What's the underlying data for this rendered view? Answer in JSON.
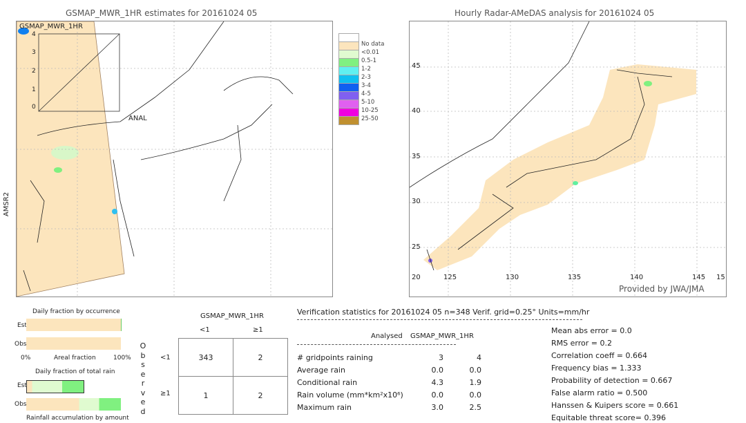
{
  "left_map": {
    "title": "GSMAP_MWR_1HR estimates for 20161024 05",
    "inset_label": "GSMAP_MWR_1HR",
    "inset_ticks": [
      "0",
      "1",
      "2",
      "3",
      "4"
    ],
    "anal_label": "ANAL",
    "side_label": "AMSR2"
  },
  "legend": {
    "items": [
      {
        "label": "",
        "color": "#ffffff"
      },
      {
        "label": "No data",
        "color": "#fce5bd"
      },
      {
        "label": "<0.01",
        "color": "#e0fbd0"
      },
      {
        "label": "0.5-1",
        "color": "#80f080"
      },
      {
        "label": "1-2",
        "color": "#60f0f0"
      },
      {
        "label": "2-3",
        "color": "#10c0f0"
      },
      {
        "label": "3-4",
        "color": "#1060f0"
      },
      {
        "label": "4-5",
        "color": "#8060f0"
      },
      {
        "label": "5-10",
        "color": "#e060f0"
      },
      {
        "label": "10-25",
        "color": "#f000e0"
      },
      {
        "label": "25-50",
        "color": "#c09030"
      }
    ]
  },
  "right_map": {
    "title": "Hourly Radar-AMeDAS analysis for 20161024 05",
    "lat_labels": [
      "45",
      "40",
      "35",
      "30",
      "25",
      "20"
    ],
    "lon_labels": [
      "125",
      "130",
      "135",
      "140",
      "145",
      "15"
    ],
    "credit": "Provided by JWA/JMA"
  },
  "occurrence": {
    "title": "Daily fraction by occurrence",
    "est": "Est",
    "obs": "Obs",
    "x0": "0%",
    "xlabel": "Areal fraction",
    "x1": "100%"
  },
  "total_rain": {
    "title": "Daily fraction of total rain",
    "est": "Est",
    "obs": "Obs",
    "footer": "Rainfall accumulation by amount"
  },
  "contingency": {
    "title": "GSMAP_MWR_1HR",
    "col_headers": [
      "<1",
      "≥1"
    ],
    "row_headers": [
      "<1",
      "≥1"
    ],
    "side_label": "Observed",
    "cells": [
      [
        "343",
        "2"
      ],
      [
        "1",
        "2"
      ]
    ]
  },
  "stats": {
    "header": "Verification statistics for 20161024 05   n=348   Verif. grid=0.25°   Units=mm/hr",
    "col_analysed": "Analysed",
    "col_est": "GSMAP_MWR_1HR",
    "rows": [
      {
        "label": "# gridpoints raining",
        "a": "3",
        "b": "4"
      },
      {
        "label": "Average rain",
        "a": "0.0",
        "b": "0.0"
      },
      {
        "label": "Conditional rain",
        "a": "4.3",
        "b": "1.9"
      },
      {
        "label": "Rain volume (mm*km²x10⁶)",
        "a": "0.0",
        "b": "0.0"
      },
      {
        "label": "Maximum rain",
        "a": "3.0",
        "b": "2.5"
      }
    ],
    "scores": [
      "Mean abs error = 0.0",
      "RMS error = 0.2",
      "Correlation coeff = 0.664",
      "Frequency bias = 1.333",
      "Probability of detection = 0.667",
      "False alarm ratio = 0.500",
      "Hanssen & Kuipers score = 0.661",
      "Equitable threat score= 0.396"
    ]
  }
}
